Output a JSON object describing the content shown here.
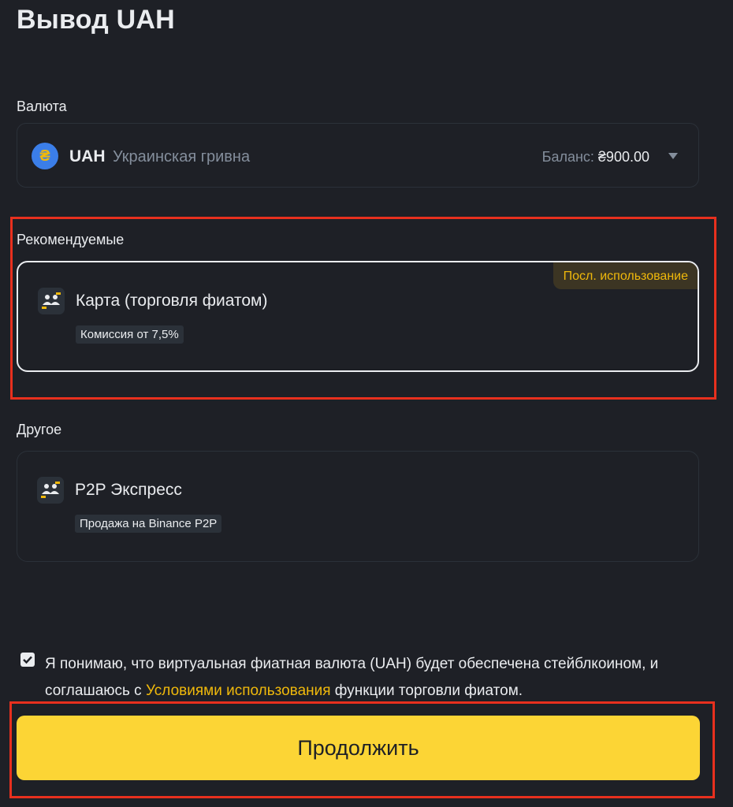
{
  "header": {
    "title": "Вывод UAH"
  },
  "currency": {
    "label": "Валюта",
    "icon": "hryvnia-coin-icon",
    "code": "UAH",
    "name": "Украинская гривна",
    "balance_label": "Баланс:",
    "balance_value": "₴900.00"
  },
  "recommended": {
    "label": "Рекомендуемые",
    "method": {
      "icon": "p2p-users-icon",
      "name": "Карта (торговля фиатом)",
      "tag": "Комиссия от 7,5%",
      "badge": "Посл. использование"
    }
  },
  "other": {
    "label": "Другое",
    "method": {
      "icon": "p2p-users-icon",
      "name": "P2P Экспресс",
      "tag": "Продажа на Binance P2P"
    }
  },
  "consent": {
    "checked": true,
    "text_before": "Я понимаю, что виртуальная фиатная валюта (UAH) будет обеспечена стейблкоином, и соглашаюсь с ",
    "link_text": "Условиями использования",
    "text_after": " функции торговли фиатом."
  },
  "actions": {
    "continue_label": "Продолжить"
  },
  "colors": {
    "background": "#1e2026",
    "accent": "#fcd535",
    "link": "#f0b90b",
    "highlight": "#e8301e"
  }
}
